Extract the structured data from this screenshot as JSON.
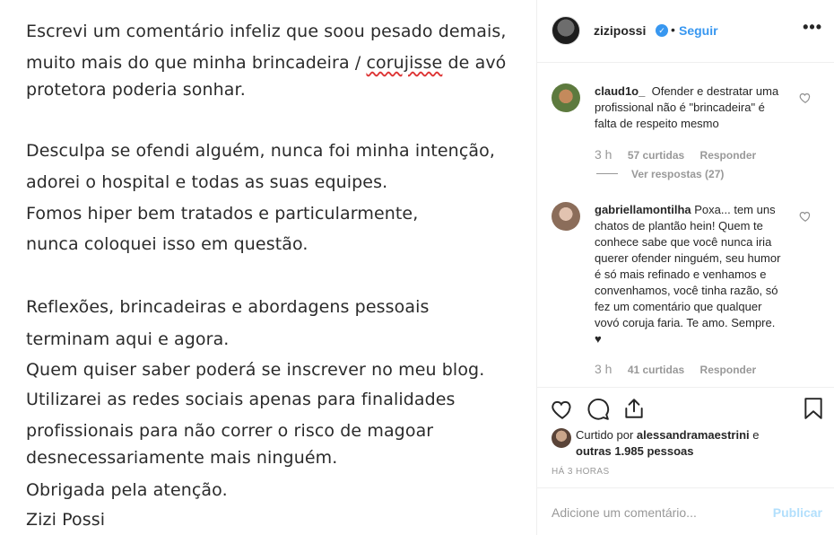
{
  "note": {
    "lines": [
      "Escrevi um comentário infeliz que soou pesado demais,",
      "muito mais do que minha brincadeira / ",
      "corujisse",
      " de avó",
      "protetora poderia  sonhar.",
      "Desculpa se ofendi alguém, nunca foi minha intenção,",
      "adorei o hospital e todas as suas equipes.",
      "Fomos hiper bem tratados e particularmente,",
      "nunca coloquei isso em questão.",
      "Reflexões, brincadeiras e abordagens pessoais",
      "terminam aqui e agora.",
      "Quem quiser saber poderá se inscrever no meu blog.",
      "Utilizarei as redes sociais apenas para finalidades",
      "profissionais para não correr o risco de magoar",
      "desnecessariamente mais ninguém.",
      "Obrigada pela atenção.",
      "Zizi Possi"
    ]
  },
  "header": {
    "username": "zizipossi",
    "verified_icon": "verified-badge-icon",
    "separator": "•",
    "follow_label": "Seguir",
    "more_label": "•••"
  },
  "comments": [
    {
      "username": "claud1o_",
      "text": "Ofender e destratar uma profissional não é \"brincadeira\" é falta de respeito mesmo",
      "time": "3 h",
      "likes": "57 curtidas",
      "reply_label": "Responder",
      "view_replies": "Ver respostas (27)"
    },
    {
      "username": "gabriellamontilha",
      "text": "Poxa... tem uns chatos de plantão hein! Quem te conhece sabe que você nunca iria querer ofender ninguém, seu humor é só mais refinado e venhamos e convenhamos, você tinha razão, só fez um comentário que qualquer vovó coruja faria. Te amo. Sempre. ♥",
      "time": "3 h",
      "likes": "41 curtidas",
      "reply_label": "Responder"
    }
  ],
  "likes": {
    "prefix": "Curtido por ",
    "user": "alessandramaestrini",
    "middle": " e",
    "others": "outras 1.985 pessoas"
  },
  "timestamp": "HÁ 3 HORAS",
  "add_comment": {
    "placeholder": "Adicione um comentário...",
    "post_label": "Publicar"
  },
  "colors": {
    "accent": "#3897f0",
    "muted": "#999999",
    "text": "#262626",
    "post_disabled": "#b2dffc"
  }
}
